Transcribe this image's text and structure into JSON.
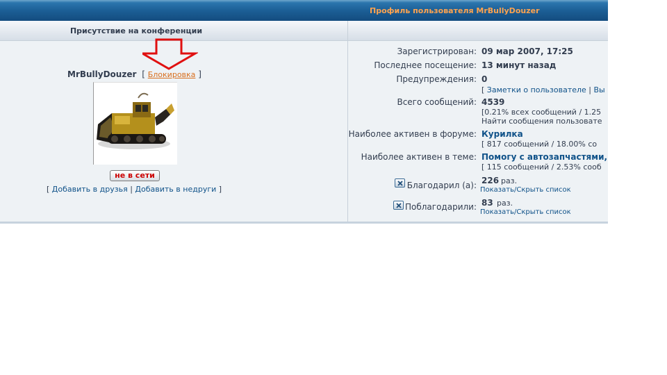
{
  "header": {
    "title": "Профиль пользователя MrBullyDouzer"
  },
  "left": {
    "section_title": "Присутствие на конференции",
    "username": "MrBullyDouzer",
    "bracket_open": "[",
    "bracket_close": "]",
    "block_link": "Блокировка",
    "status_button": "не в сети",
    "add_friend": "Добавить в друзья",
    "add_foe": "Добавить в недруги",
    "separator": "|"
  },
  "right": {
    "registered_label": "Зарегистрирован:",
    "registered_value": "09 мар 2007, 17:25",
    "last_visit_label": "Последнее посещение:",
    "last_visit_value": "13 минут назад",
    "warnings_label": "Предупреждения:",
    "warnings_value": "0",
    "notes_link": "Заметки о пользователе",
    "notes_more": "Вы",
    "total_posts_label": "Всего сообщений:",
    "total_posts_value": "4539",
    "total_posts_detail": "[0.21% всех сообщений / 1.25",
    "find_posts_link": "Найти сообщения пользовате",
    "active_forum_label": "Наиболее активен в форуме:",
    "active_forum_value": "Курилка",
    "active_forum_detail": "[ 817 сообщений / 18.00% со",
    "active_topic_label": "Наиболее активен в теме:",
    "active_topic_value": "Помогу с автозапчастями,",
    "active_topic_detail": "[ 115 сообщений / 2.53% сооб",
    "thanked_label": "Благодарил (а):",
    "thanked_count": "226",
    "thanked_unit": "раз.",
    "thanked_toggle": "Показать/Скрыть список",
    "thanked_by_label": "Поблагодарили:",
    "thanked_by_count": "83",
    "thanked_by_unit": "раз.",
    "thanked_by_toggle": "Показать/Скрыть список"
  },
  "colors": {
    "header_bg": "#1c5f96",
    "header_title": "#ffa34f",
    "link": "#105289",
    "block_link": "#d86f1d",
    "arrow": "#e01010",
    "offline": "#cc0000"
  }
}
